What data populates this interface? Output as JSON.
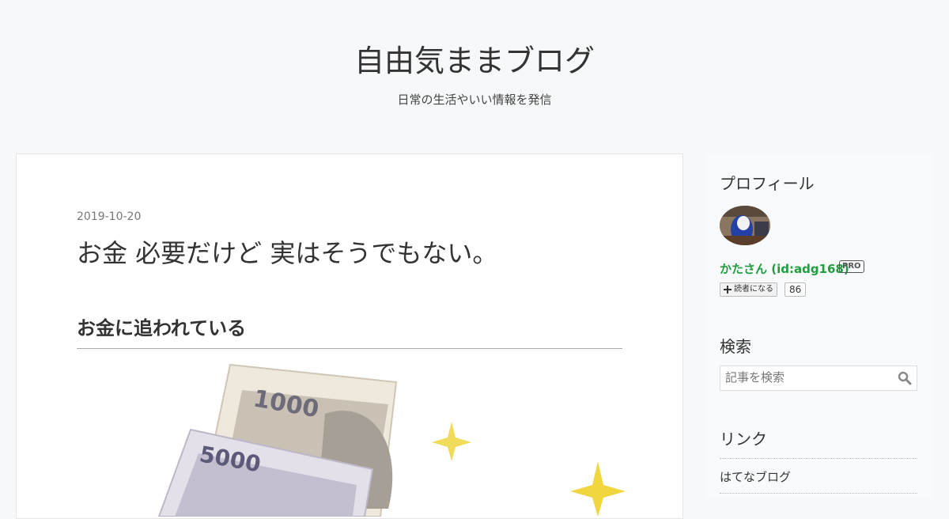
{
  "header": {
    "blog_title": "自由気ままブログ",
    "description": "日常の生活やいい情報を発信"
  },
  "entry": {
    "date": "2019-10-20",
    "title": "お金 必要だけど 実はそうでもない。",
    "section_heading": "お金に追われている",
    "image_icon": "yen-banknotes-illustration",
    "banknote_labels": [
      "1000",
      "5000"
    ]
  },
  "sidebar": {
    "profile": {
      "heading": "プロフィール",
      "name": "かたさん (id:adg168)",
      "badge": "PRO",
      "subscribe_label": "読者になる",
      "subscriber_count": "86",
      "avatar_icon": "user-avatar"
    },
    "search": {
      "heading": "検索",
      "placeholder": "記事を検索",
      "icon": "search-icon"
    },
    "links": {
      "heading": "リンク",
      "items": [
        "はてなブログ"
      ]
    }
  },
  "colors": {
    "background": "#f7f8f9",
    "profile_name": "#1e9e3e",
    "text": "#333333"
  }
}
